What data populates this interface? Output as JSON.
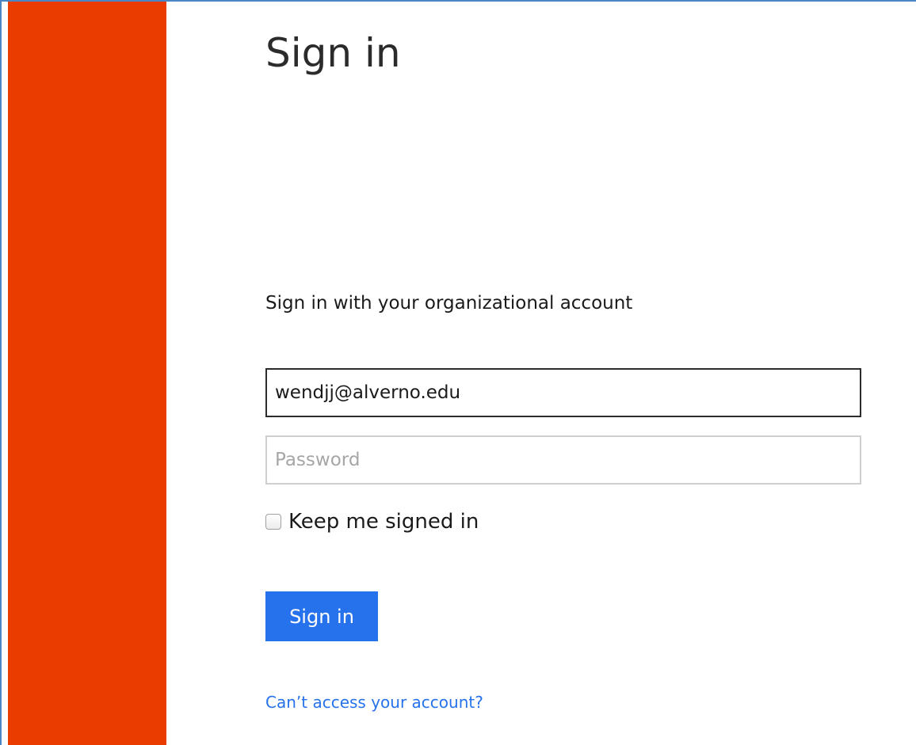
{
  "page": {
    "title": "Sign in",
    "subtitle": "Sign in with your organizational account"
  },
  "form": {
    "email": {
      "value": "wendjj@alverno.edu",
      "placeholder": ""
    },
    "password": {
      "value": "",
      "placeholder": "Password"
    },
    "keep_signed_in": {
      "label": "Keep me signed in",
      "checked": false
    },
    "submit_label": "Sign in",
    "help_link": "Can’t access your account?"
  },
  "colors": {
    "brand": "#eb3c00",
    "accent": "#2672ec",
    "text": "#1a1a1a",
    "placeholder": "#a6a6a6"
  }
}
